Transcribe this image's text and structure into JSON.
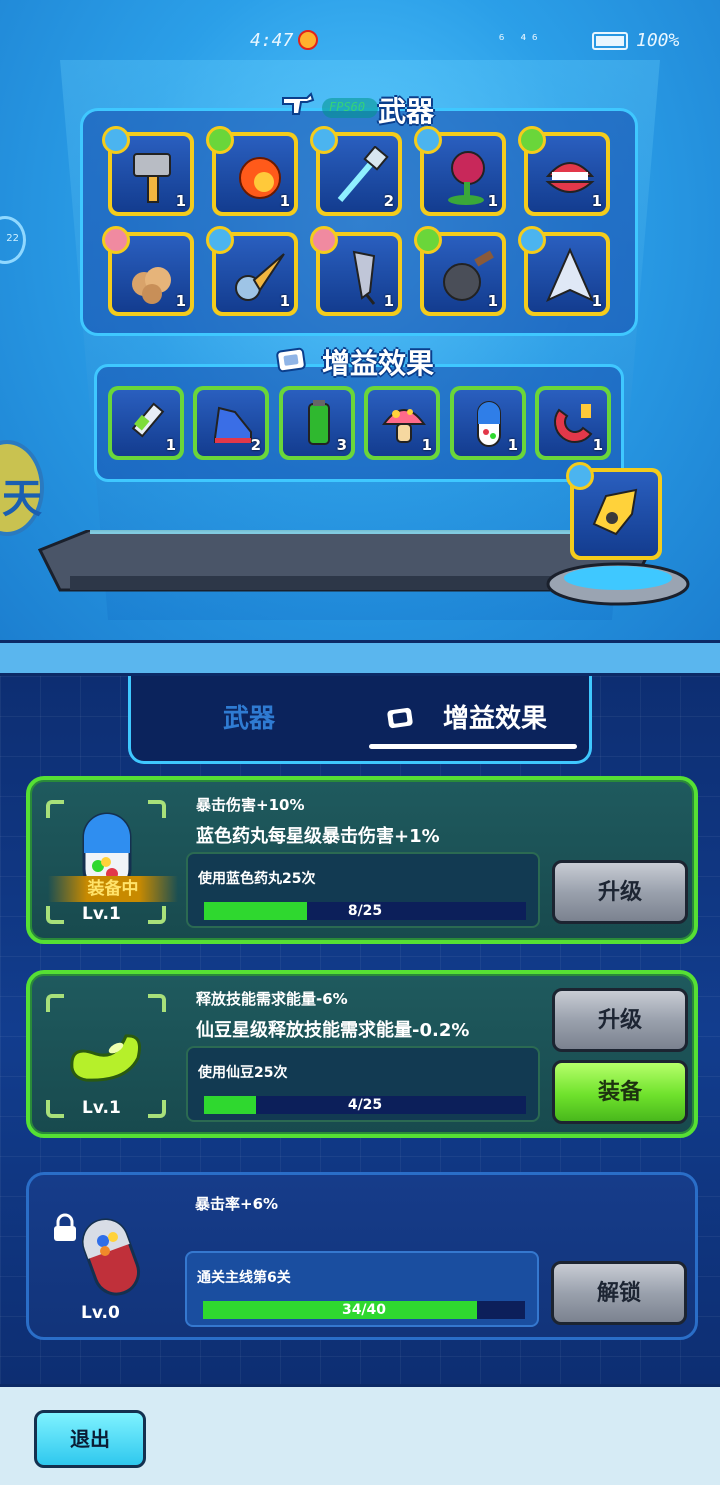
{
  "status_bar": {
    "time": "4:47",
    "network": "⁶ ⁴⁶",
    "battery": "100%"
  },
  "top": {
    "weapons_title": "武器",
    "fps_label": "FPS60",
    "buffs_title": "增益效果",
    "side_widget": "22",
    "side_badge": "天",
    "weapons": [
      {
        "name": "hammer",
        "level": "1"
      },
      {
        "name": "fireball",
        "level": "1"
      },
      {
        "name": "laser-wand",
        "level": "2"
      },
      {
        "name": "piranha-plant",
        "level": "1"
      },
      {
        "name": "chattering-teeth",
        "level": "1"
      },
      {
        "name": "dust-cloud",
        "level": "1"
      },
      {
        "name": "drill",
        "level": "1"
      },
      {
        "name": "umbrella",
        "level": "1"
      },
      {
        "name": "frying-pan",
        "level": "1"
      },
      {
        "name": "paper-plane",
        "level": "1"
      }
    ],
    "buffs": [
      {
        "name": "syringe",
        "level": "1"
      },
      {
        "name": "sneaker",
        "level": "2"
      },
      {
        "name": "battery",
        "level": "3"
      },
      {
        "name": "mushroom",
        "level": "1"
      },
      {
        "name": "blue-pill",
        "level": "1"
      },
      {
        "name": "magnet",
        "level": "1"
      }
    ]
  },
  "tabs": {
    "weapons": "武器",
    "buffs": "增益效果",
    "active": "buffs"
  },
  "cards": [
    {
      "line1": "暴击伤害+10%",
      "line2": "蓝色药丸每星级暴击伤害+1%",
      "equipped": "装备中",
      "level": "Lv.1",
      "task": "使用蓝色药丸25次",
      "progress_text": "8/25",
      "progress": 0.32,
      "button": "升级"
    },
    {
      "line1": "释放技能需求能量-6%",
      "line2": "仙豆星级释放技能需求能量-0.2%",
      "level": "Lv.1",
      "task": "使用仙豆25次",
      "progress_text": "4/25",
      "progress": 0.16,
      "button_upgrade": "升级",
      "button_equip": "装备"
    },
    {
      "line1": "暴击率+6%",
      "level": "Lv.0",
      "task": "通关主线第6关",
      "progress_text": "34/40",
      "progress": 0.85,
      "button": "解锁"
    }
  ],
  "exit_button": "退出",
  "colors": {
    "accent_green": "#56e034",
    "slot_gold": "#f4cc1c",
    "panel_blue": "#3fc8ff"
  }
}
